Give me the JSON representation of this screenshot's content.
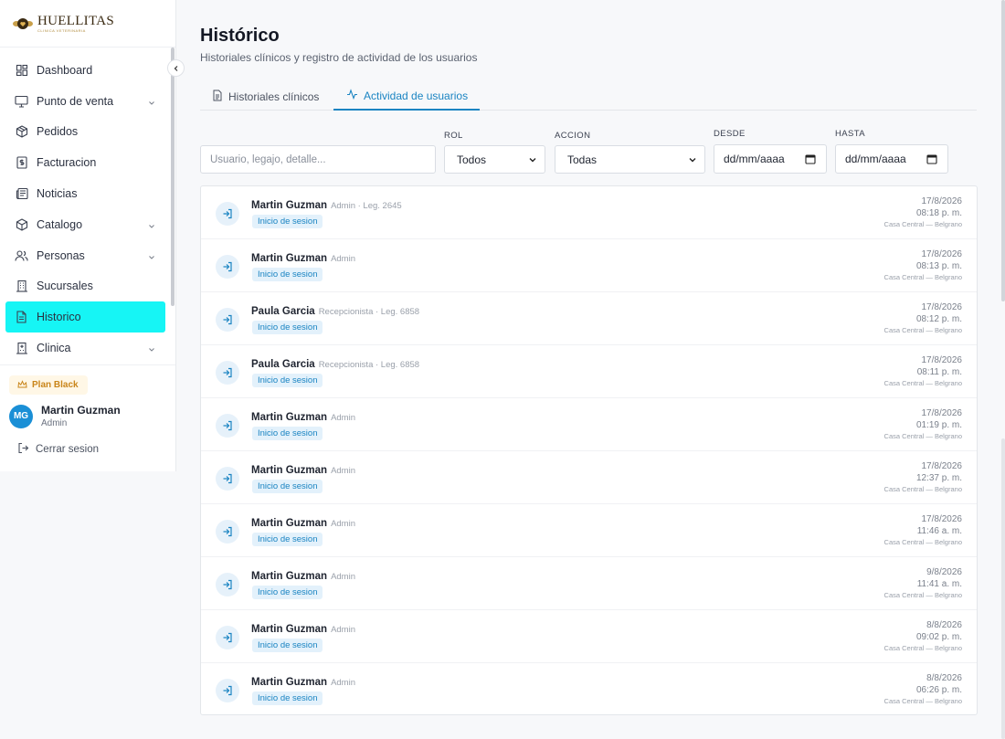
{
  "app": {
    "logo_title": "HUELLITAS",
    "logo_subtitle": "CLINICA VETERINARIA"
  },
  "sidebar": {
    "items": [
      {
        "label": "Dashboard",
        "icon": "dashboard-icon",
        "chevron": false,
        "active": false
      },
      {
        "label": "Punto de venta",
        "icon": "monitor-icon",
        "chevron": true,
        "active": false
      },
      {
        "label": "Pedidos",
        "icon": "package-icon",
        "chevron": false,
        "active": false
      },
      {
        "label": "Facturacion",
        "icon": "receipt-icon",
        "chevron": false,
        "active": false
      },
      {
        "label": "Noticias",
        "icon": "newspaper-icon",
        "chevron": false,
        "active": false
      },
      {
        "label": "Catalogo",
        "icon": "box-icon",
        "chevron": true,
        "active": false
      },
      {
        "label": "Personas",
        "icon": "users-icon",
        "chevron": true,
        "active": false
      },
      {
        "label": "Sucursales",
        "icon": "building-icon",
        "chevron": false,
        "active": false
      },
      {
        "label": "Historico",
        "icon": "file-icon",
        "chevron": false,
        "active": true
      },
      {
        "label": "Clinica",
        "icon": "hospital-icon",
        "chevron": true,
        "active": false
      }
    ],
    "plan_label": "Plan Black",
    "user": {
      "initials": "MG",
      "name": "Martin Guzman",
      "role": "Admin"
    },
    "logout_label": "Cerrar sesion"
  },
  "page": {
    "title": "Histórico",
    "subtitle": "Historiales clínicos y registro de actividad de los usuarios"
  },
  "tabs": [
    {
      "label": "Historiales clínicos",
      "active": false
    },
    {
      "label": "Actividad de usuarios",
      "active": true
    }
  ],
  "filters": {
    "search_placeholder": "Usuario, legajo, detalle...",
    "rol_label": "ROL",
    "rol_value": "Todos",
    "accion_label": "ACCION",
    "accion_value": "Todas",
    "desde_label": "DESDE",
    "desde_value": "dd/mm/aaaa",
    "hasta_label": "HASTA",
    "hasta_value": "dd/mm/aaaa"
  },
  "activity": [
    {
      "name": "Martin Guzman",
      "meta": "Admin · Leg. 2645",
      "action": "Inicio de sesion",
      "date": "17/8/2026",
      "time": "08:18 p. m.",
      "location": "Casa Central — Belgrano"
    },
    {
      "name": "Martin Guzman",
      "meta": "Admin",
      "action": "Inicio de sesion",
      "date": "17/8/2026",
      "time": "08:13 p. m.",
      "location": "Casa Central — Belgrano"
    },
    {
      "name": "Paula Garcia",
      "meta": "Recepcionista · Leg. 6858",
      "action": "Inicio de sesion",
      "date": "17/8/2026",
      "time": "08:12 p. m.",
      "location": "Casa Central — Belgrano"
    },
    {
      "name": "Paula Garcia",
      "meta": "Recepcionista · Leg. 6858",
      "action": "Inicio de sesion",
      "date": "17/8/2026",
      "time": "08:11 p. m.",
      "location": "Casa Central — Belgrano"
    },
    {
      "name": "Martin Guzman",
      "meta": "Admin",
      "action": "Inicio de sesion",
      "date": "17/8/2026",
      "time": "01:19 p. m.",
      "location": "Casa Central — Belgrano"
    },
    {
      "name": "Martin Guzman",
      "meta": "Admin",
      "action": "Inicio de sesion",
      "date": "17/8/2026",
      "time": "12:37 p. m.",
      "location": "Casa Central — Belgrano"
    },
    {
      "name": "Martin Guzman",
      "meta": "Admin",
      "action": "Inicio de sesion",
      "date": "17/8/2026",
      "time": "11:46 a. m.",
      "location": "Casa Central — Belgrano"
    },
    {
      "name": "Martin Guzman",
      "meta": "Admin",
      "action": "Inicio de sesion",
      "date": "9/8/2026",
      "time": "11:41 a. m.",
      "location": "Casa Central — Belgrano"
    },
    {
      "name": "Martin Guzman",
      "meta": "Admin",
      "action": "Inicio de sesion",
      "date": "8/8/2026",
      "time": "09:02 p. m.",
      "location": "Casa Central — Belgrano"
    },
    {
      "name": "Martin Guzman",
      "meta": "Admin",
      "action": "Inicio de sesion",
      "date": "8/8/2026",
      "time": "06:26 p. m.",
      "location": "Casa Central — Belgrano"
    }
  ],
  "colors": {
    "accent": "#1a84c2",
    "active_nav": "#16f5f5",
    "avatar": "#1a8fd6",
    "plan_text": "#c9851a"
  }
}
